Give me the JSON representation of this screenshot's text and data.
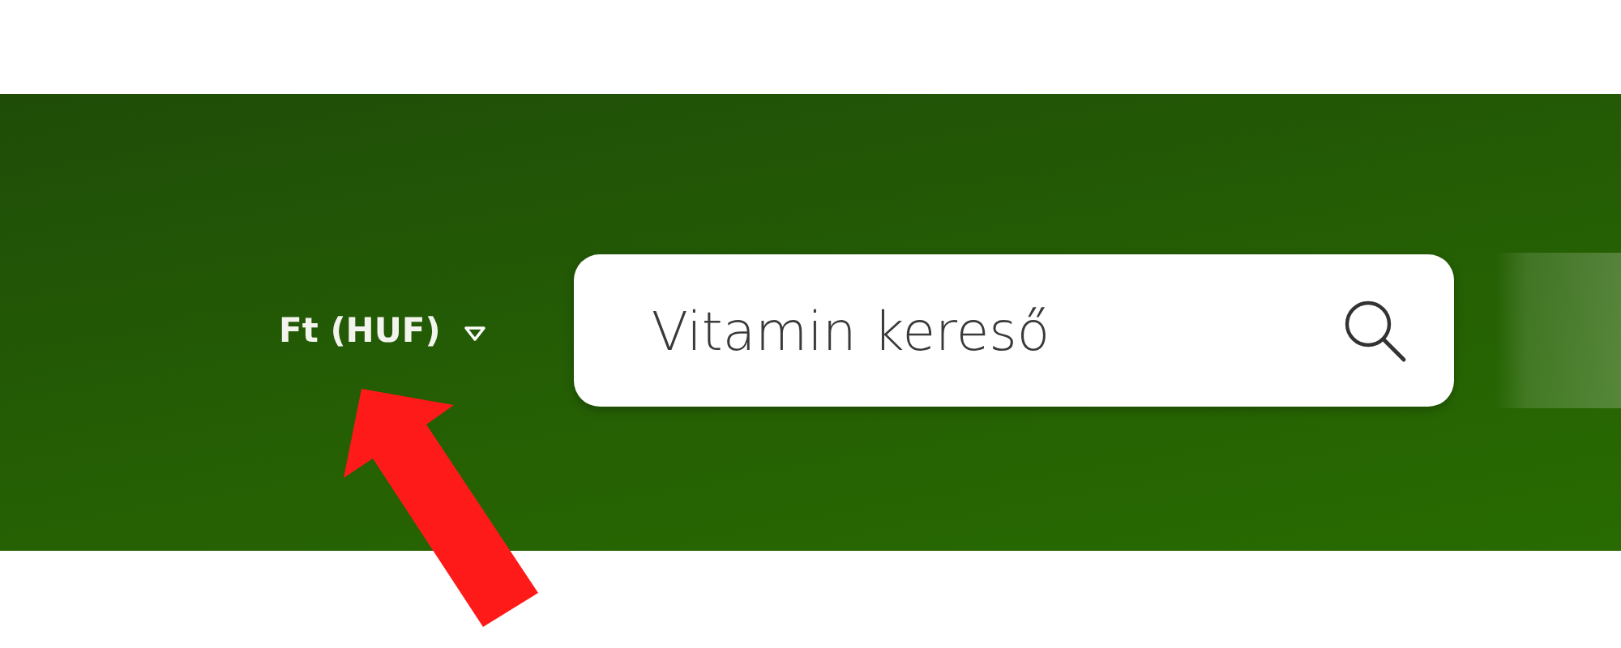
{
  "header": {
    "currency": {
      "label": "Ft (HUF)"
    },
    "search": {
      "placeholder": "Vitamin kereső"
    }
  }
}
